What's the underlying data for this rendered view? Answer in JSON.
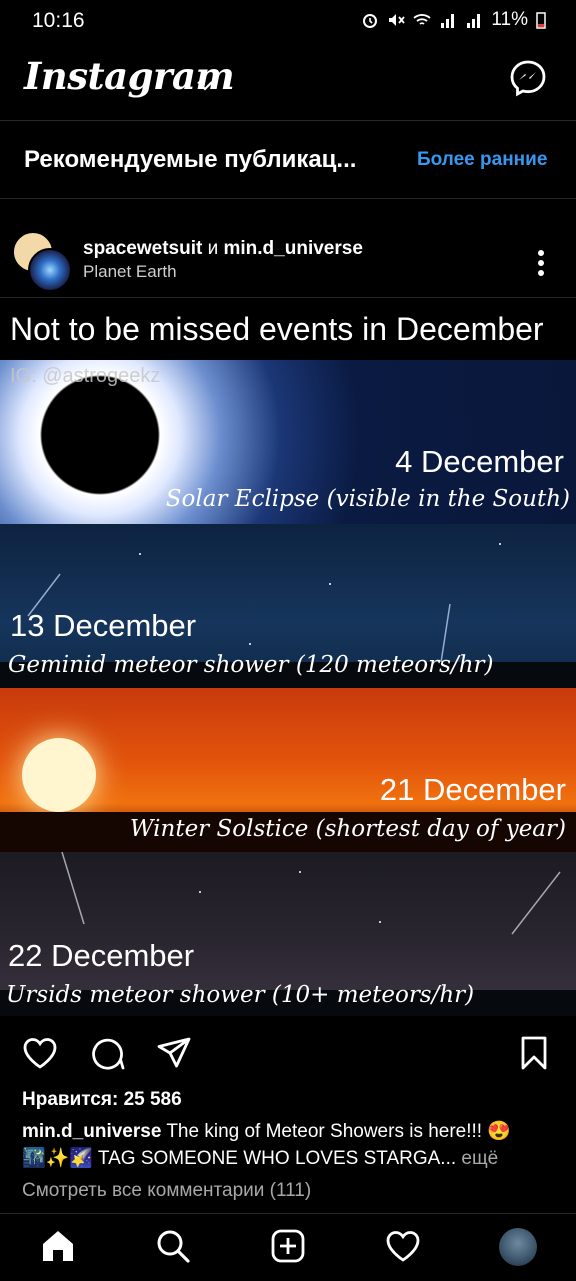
{
  "status_bar": {
    "time": "10:16",
    "battery": "11%"
  },
  "header": {
    "logo": "Instagram"
  },
  "recommended": {
    "title": "Рекомендуемые публикац...",
    "older_link": "Более ранние"
  },
  "post": {
    "author1": "spacewetsuit",
    "conjunction": " и ",
    "author2": "min.d_universe",
    "location": "Planet Earth",
    "media_title": "Not to be missed events in December",
    "watermark": "IG: @astrogeekz",
    "panels": [
      {
        "date": "4 December",
        "desc": "Solar Eclipse (visible in the South)"
      },
      {
        "date": "13 December",
        "desc": "Geminid meteor shower (120 meteors/hr)"
      },
      {
        "date": "21 December",
        "desc": "Winter Solstice (shortest day of year)"
      },
      {
        "date": "22 December",
        "desc": "Ursids meteor shower (10+ meteors/hr)"
      }
    ],
    "likes": "Нравится: 25 586",
    "caption_user": "min.d_universe",
    "caption_line1": " The king of Meteor Showers is here!!! 😍",
    "caption_line2": "🌃✨🌠 TAG SOMEONE WHO LOVES STARGA...",
    "more": " ещё",
    "view_comments": "Смотреть все комментарии (111)"
  }
}
